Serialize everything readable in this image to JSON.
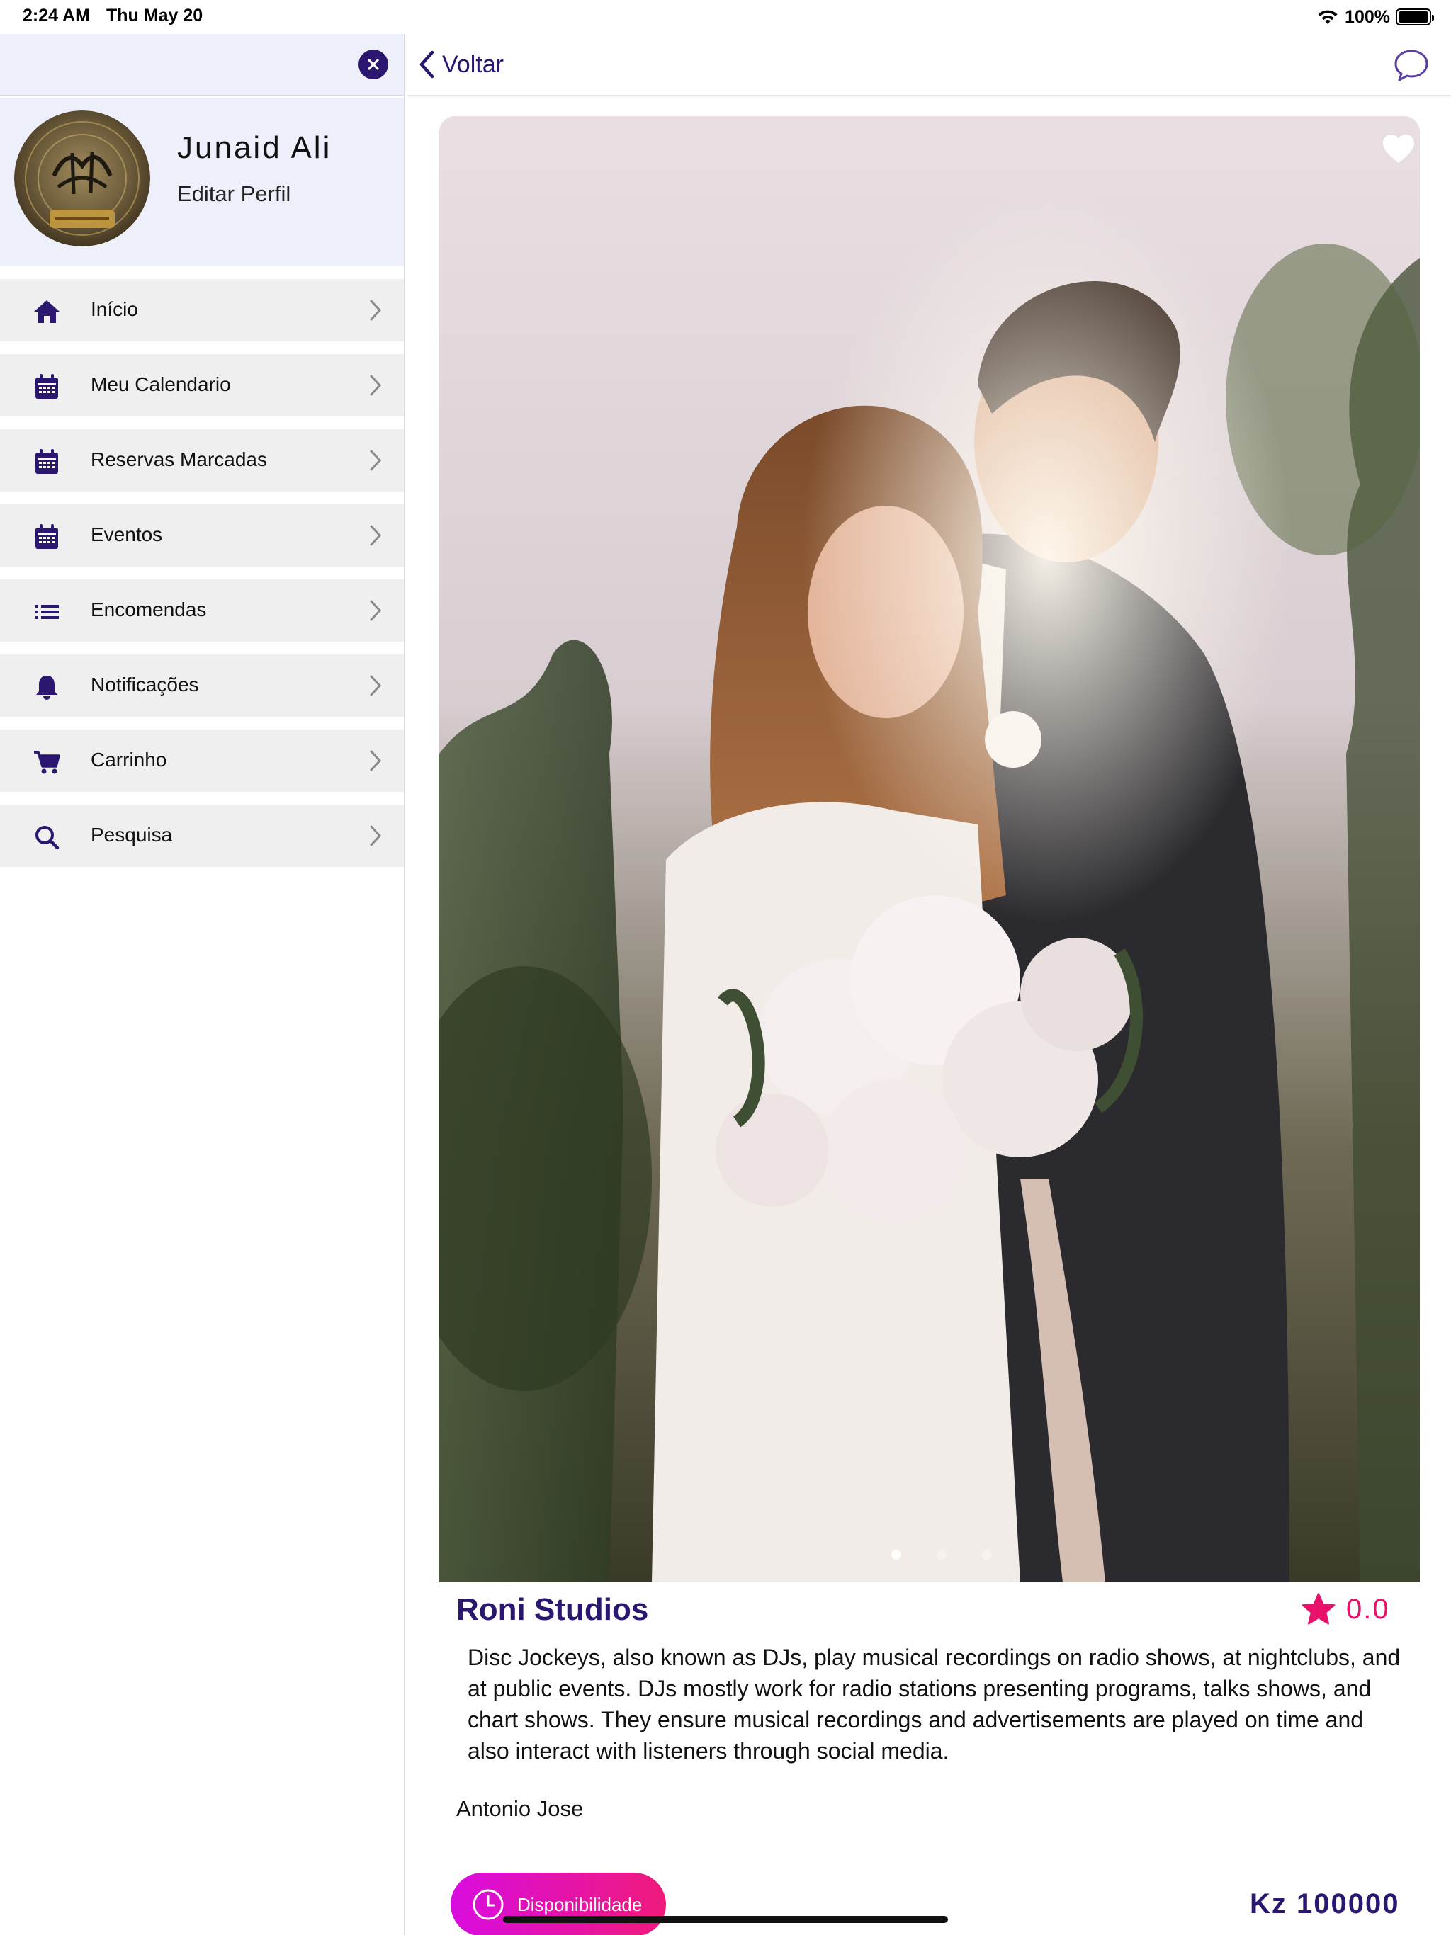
{
  "status_bar": {
    "time": "2:24 AM",
    "date": "Thu May 20",
    "battery": "100%"
  },
  "sidebar": {
    "profile": {
      "name": "Junaid Ali",
      "edit_label": "Editar Perfil"
    },
    "items": [
      {
        "label": "Início",
        "icon": "home-icon"
      },
      {
        "label": "Meu Calendario",
        "icon": "calendar-icon"
      },
      {
        "label": "Reservas Marcadas",
        "icon": "calendar-icon"
      },
      {
        "label": "Eventos",
        "icon": "calendar-icon"
      },
      {
        "label": "Encomendas",
        "icon": "list-icon"
      },
      {
        "label": "Notificações",
        "icon": "bell-icon"
      },
      {
        "label": "Carrinho",
        "icon": "cart-icon"
      },
      {
        "label": "Pesquisa",
        "icon": "search-icon"
      }
    ]
  },
  "header": {
    "back_label": "Voltar"
  },
  "listing": {
    "title": "Roni Studios",
    "rating": "0.0",
    "description": "Disc Jockeys, also known as DJs, play musical recordings on radio shows, at nightclubs, and at public events. DJs mostly work for radio stations presenting programs, talks shows, and chart shows. They ensure musical recordings and advertisements are played on time and also interact with listeners through social media.",
    "owner": "Antonio Jose",
    "availability_label": "Disponibilidade",
    "price": "Kz 100000",
    "carousel": {
      "active_index": 0,
      "count": 3
    }
  },
  "colors": {
    "primary": "#2b1670",
    "accent": "#e8126c",
    "gradient_start": "#d90ce0",
    "panel": "#edf0fa",
    "menu_bg": "#efefef"
  }
}
